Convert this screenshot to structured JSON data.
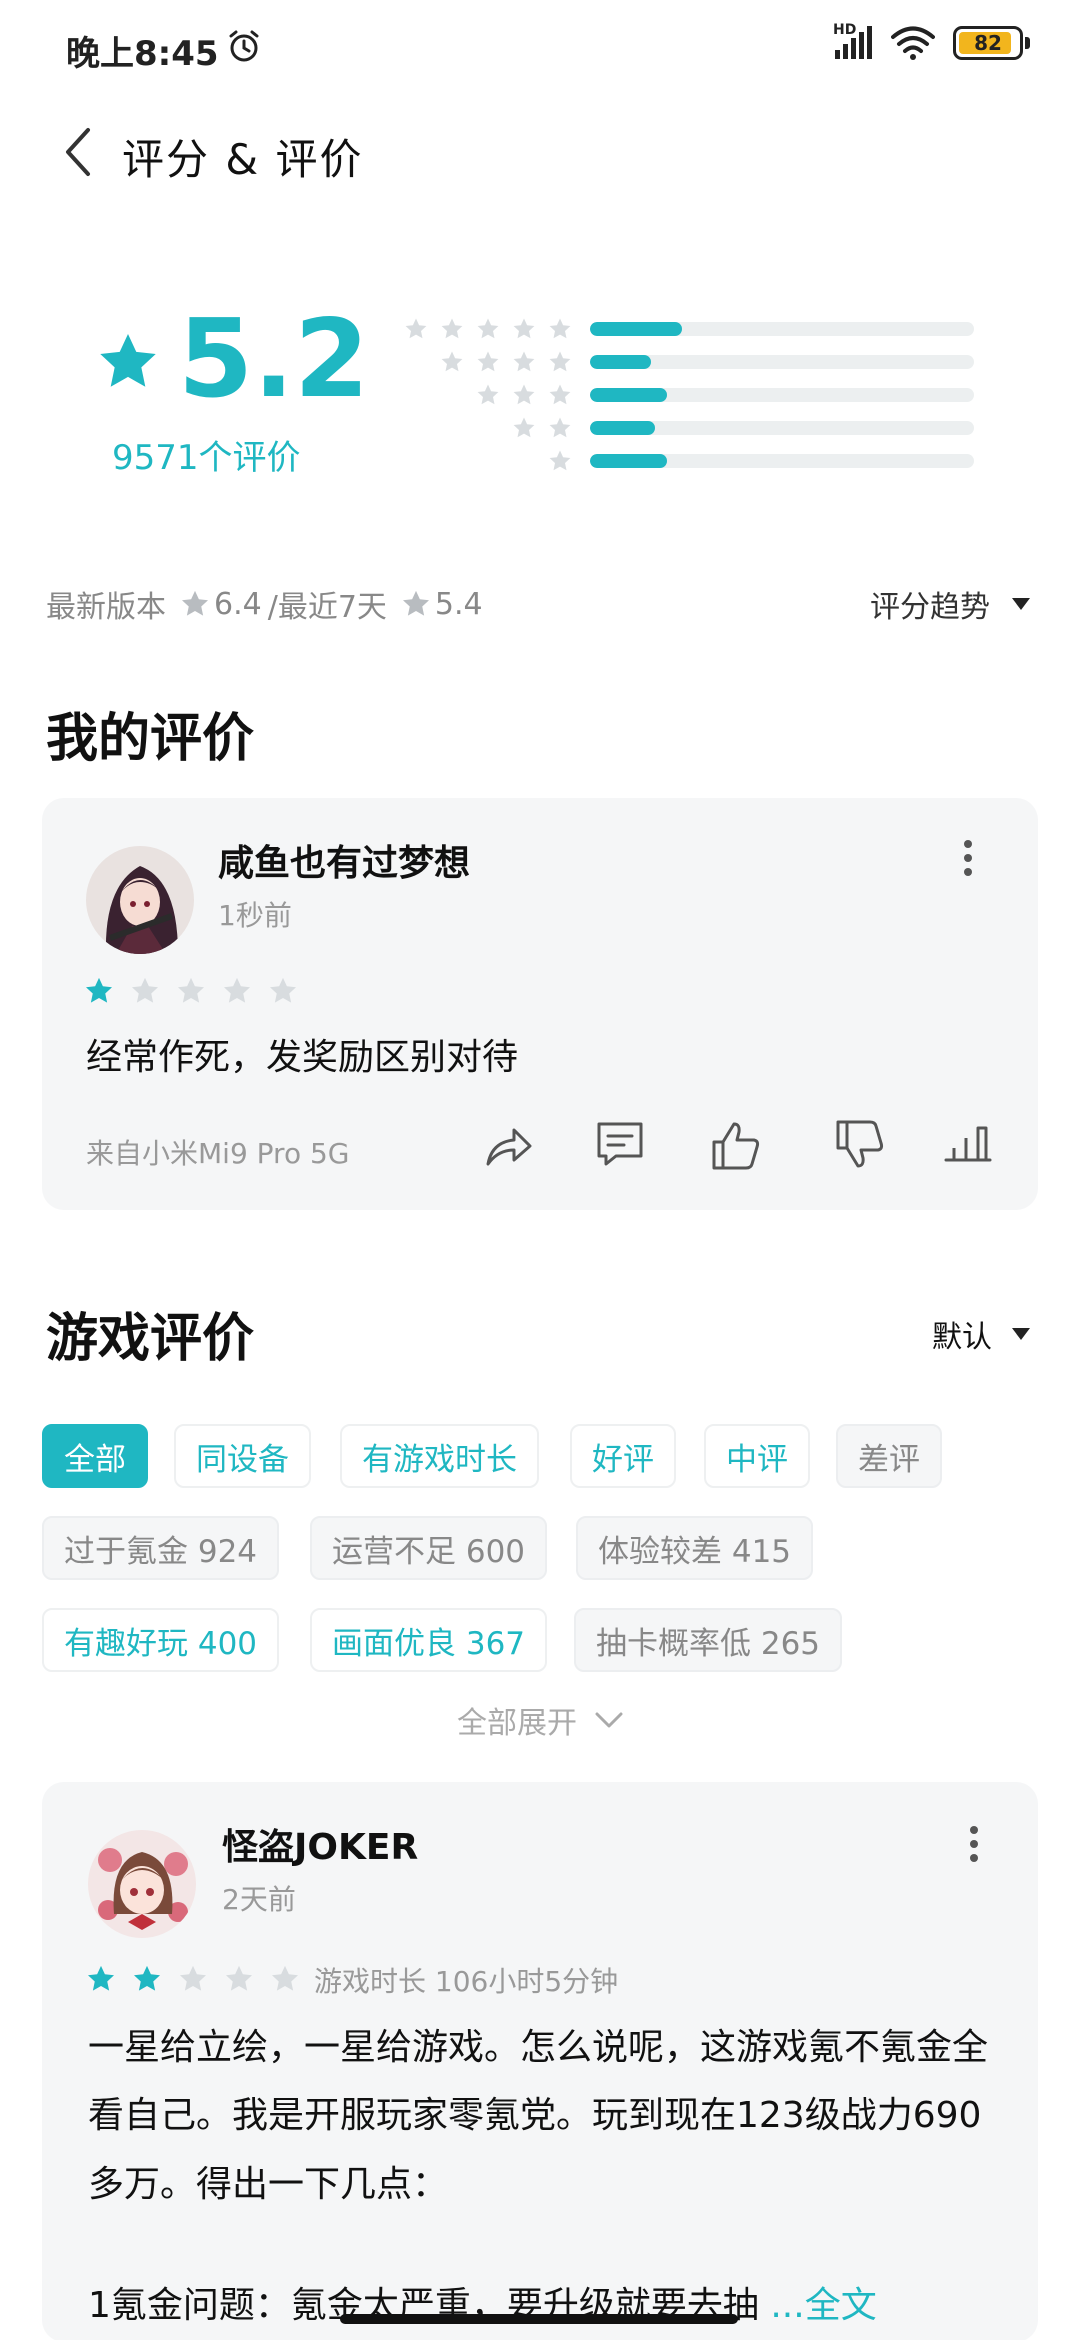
{
  "status_bar": {
    "time": "晚上8:45",
    "hd": "HD",
    "battery": "82"
  },
  "header": {
    "title": "评分 & 评价"
  },
  "summary": {
    "score": "5.2",
    "review_count": "9571个评价",
    "distribution": [
      {
        "stars": 5,
        "fraction": 0.24
      },
      {
        "stars": 4,
        "fraction": 0.16
      },
      {
        "stars": 3,
        "fraction": 0.2
      },
      {
        "stars": 2,
        "fraction": 0.17
      },
      {
        "stars": 1,
        "fraction": 0.2
      }
    ]
  },
  "version": {
    "latest_label": "最新版本",
    "latest_score": "6.4",
    "recent_label": "/最近7天",
    "recent_score": "5.4",
    "trend_label": "评分趋势"
  },
  "my_review": {
    "section_title": "我的评价",
    "username": "咸鱼也有过梦想",
    "time_ago": "1秒前",
    "rating": 1,
    "text": "经常作死，发奖励区别对待",
    "device": "来自小米Mi9 Pro 5G"
  },
  "game_reviews": {
    "section_title": "游戏评价",
    "sort_label": "默认",
    "tags": [
      {
        "label": "全部",
        "style": "active"
      },
      {
        "label": "同设备",
        "style": "teal"
      },
      {
        "label": "有游戏时长",
        "style": "teal"
      },
      {
        "label": "好评",
        "style": "teal"
      },
      {
        "label": "中评",
        "style": "teal"
      },
      {
        "label": "差评",
        "style": "grey"
      },
      {
        "label": "过于氪金 924",
        "style": "grey"
      },
      {
        "label": "运营不足 600",
        "style": "grey"
      },
      {
        "label": "体验较差 415",
        "style": "grey"
      },
      {
        "label": "有趣好玩 400",
        "style": "teal"
      },
      {
        "label": "画面优良 367",
        "style": "teal"
      },
      {
        "label": "抽卡概率低 265",
        "style": "grey"
      }
    ],
    "expand_label": "全部展开"
  },
  "review_1": {
    "username": "怪盗JOKER",
    "time_ago": "2天前",
    "rating": 2,
    "playtime": "游戏时长 106小时5分钟",
    "text": "一星给立绘，一星给游戏。怎么说呢，这游戏氪不氪金全看自己。我是开服玩家零氪党。玩到现在123级战力690多万。得出一下几点：",
    "text_cut": "1氪金问题：氪金太严重，要升级就要去抽",
    "more": "...全文"
  },
  "colors": {
    "accent": "#1fb7c2",
    "star_empty": "#d8dcdf",
    "card_bg": "#f5f6f7"
  }
}
